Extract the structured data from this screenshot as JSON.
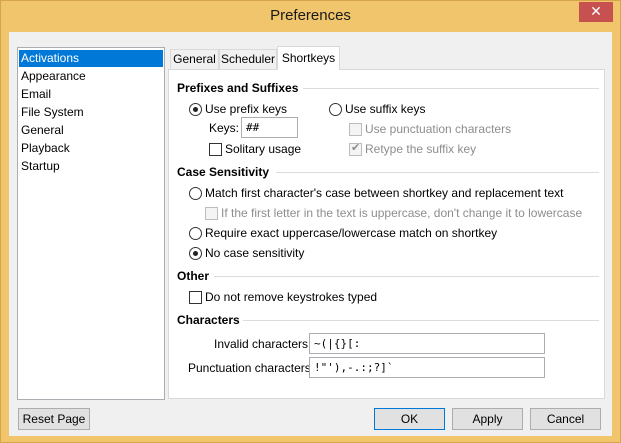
{
  "window": {
    "title": "Preferences",
    "close_glyph": "✕"
  },
  "sidebar": {
    "items": [
      {
        "label": "Activations",
        "selected": true
      },
      {
        "label": "Appearance"
      },
      {
        "label": "Email"
      },
      {
        "label": "File System"
      },
      {
        "label": "General"
      },
      {
        "label": "Playback"
      },
      {
        "label": "Startup"
      }
    ]
  },
  "tabs": [
    {
      "label": "General"
    },
    {
      "label": "Scheduler"
    },
    {
      "label": "Shortkeys",
      "active": true
    }
  ],
  "prefixes": {
    "title": "Prefixes and Suffixes",
    "prefix_label": "Use prefix keys",
    "prefix_selected": true,
    "keys_label": "Keys:",
    "keys_value": "##",
    "solitary_label": "Solitary usage",
    "solitary_checked": false,
    "suffix_label": "Use suffix keys",
    "suffix_selected": false,
    "punct_label": "Use punctuation characters",
    "punct_checked": false,
    "retype_label": "Retype the suffix key",
    "retype_checked": true
  },
  "case": {
    "title": "Case Sensitivity",
    "match_first_label": "Match first character's case between shortkey and replacement text",
    "first_letter_label": "If the first letter in the text is uppercase, don't change it to lowercase",
    "exact_label": "Require exact uppercase/lowercase match on shortkey",
    "none_label": "No case sensitivity",
    "selected": "none"
  },
  "other": {
    "title": "Other",
    "no_remove_label": "Do not remove keystrokes typed",
    "no_remove_checked": false
  },
  "characters": {
    "title": "Characters",
    "invalid_label": "Invalid characters:",
    "invalid_value": "~(|{}[:",
    "punct_label": "Punctuation characters:",
    "punct_value": "!\"'),-.:;?]`"
  },
  "buttons": {
    "reset": "Reset Page",
    "ok": "OK",
    "apply": "Apply",
    "cancel": "Cancel"
  }
}
